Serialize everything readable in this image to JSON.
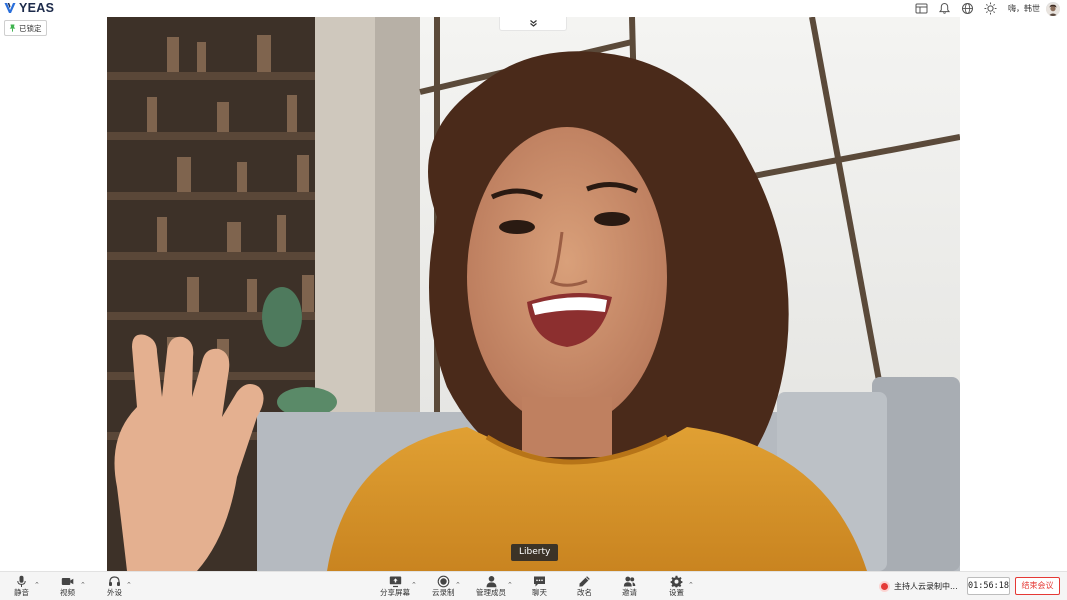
{
  "app": {
    "logo_text": "YEAS",
    "brand_color": "#2a6fdb"
  },
  "header": {
    "icons": [
      "layout-icon",
      "bell-icon",
      "globe-icon",
      "brightness-icon"
    ],
    "greeting": "嗨，韩世"
  },
  "lock_badge": {
    "label": "已锁定",
    "color": "#3fb34f"
  },
  "stage": {
    "participant_name": "Liberty"
  },
  "toolbar": {
    "left": [
      {
        "name": "mute",
        "label": "静音",
        "icon": "microphone-icon"
      },
      {
        "name": "video",
        "label": "视频",
        "icon": "camera-icon"
      },
      {
        "name": "audio-device",
        "label": "外设",
        "icon": "headset-icon"
      }
    ],
    "center": [
      {
        "name": "share-screen",
        "label": "分享屏幕",
        "icon": "screen-share-icon"
      },
      {
        "name": "cloud-record",
        "label": "云录制",
        "icon": "record-icon"
      },
      {
        "name": "manage-members",
        "label": "管理成员",
        "icon": "person-icon"
      },
      {
        "name": "chat",
        "label": "聊天",
        "icon": "chat-icon"
      },
      {
        "name": "rename",
        "label": "改名",
        "icon": "pencil-icon"
      },
      {
        "name": "invite",
        "label": "邀请",
        "icon": "invite-icon"
      },
      {
        "name": "settings",
        "label": "设置",
        "icon": "gear-icon"
      }
    ],
    "recording_status": "主持人云录制中...",
    "timer": "01:56:18",
    "end_meeting": "结束会议",
    "danger_color": "#e53935"
  }
}
